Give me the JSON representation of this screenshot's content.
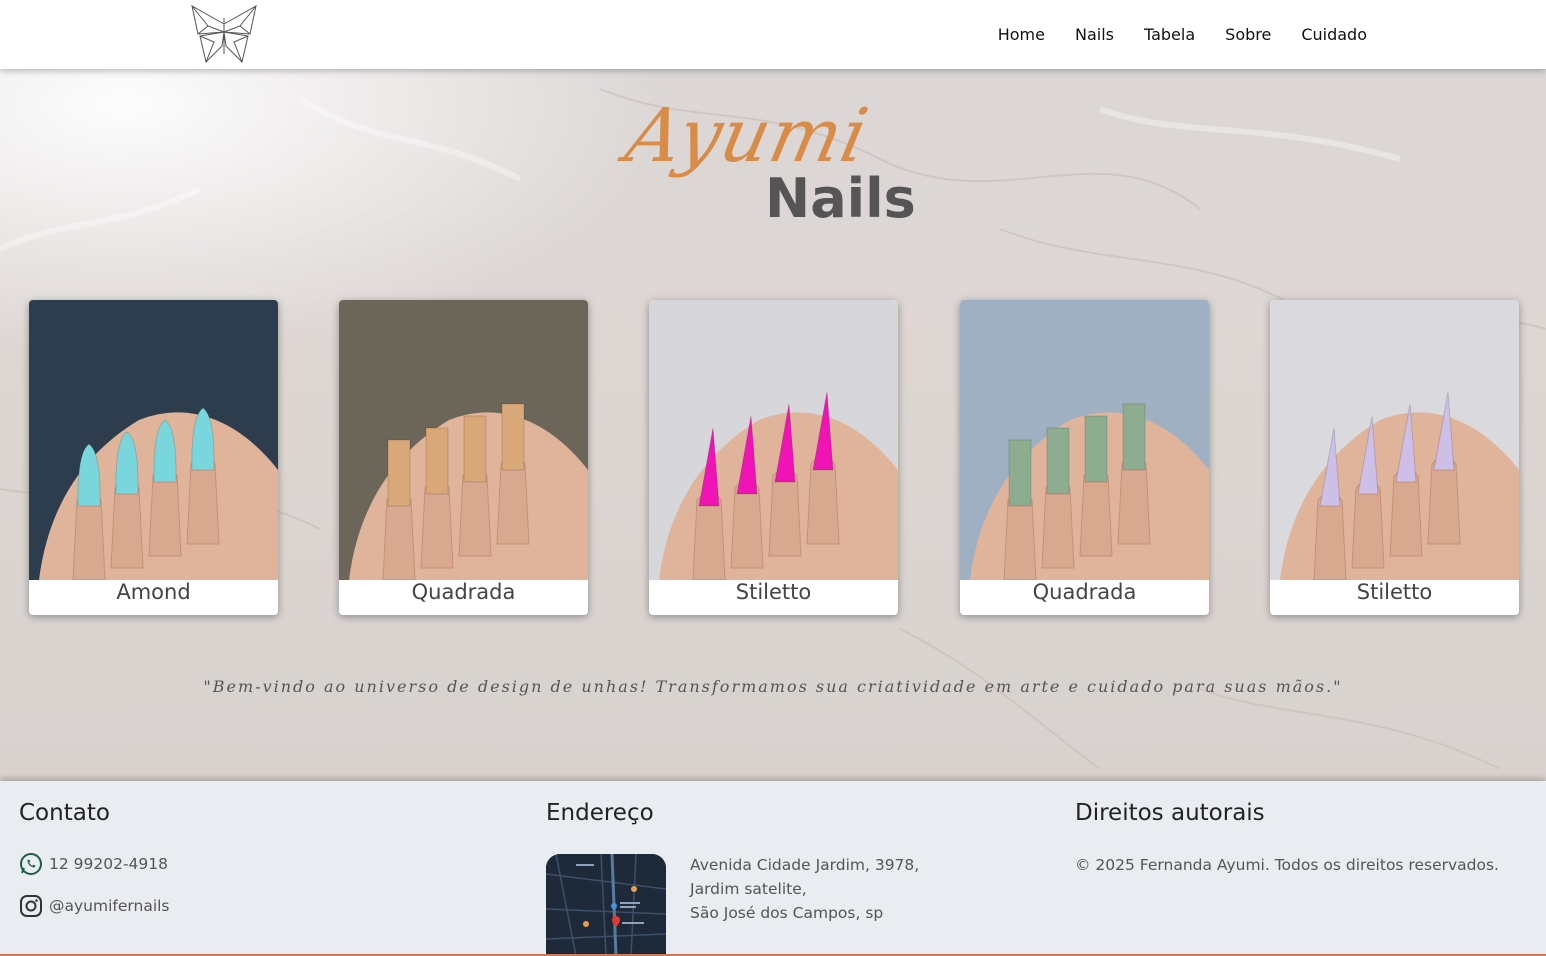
{
  "nav": {
    "items": [
      "Home",
      "Nails",
      "Tabela",
      "Sobre",
      "Cuidado"
    ]
  },
  "brand": {
    "script": "Ayumi",
    "bold": "Nails",
    "script_color": "#d98c48",
    "bold_color": "#555555"
  },
  "gallery": [
    {
      "label": "Amond",
      "nail_color": "#79d6dc"
    },
    {
      "label": "Quadrada",
      "nail_color": "#d9a878"
    },
    {
      "label": "Stiletto",
      "nail_color": "#f013b6"
    },
    {
      "label": "Quadrada",
      "nail_color": "#8eac90"
    },
    {
      "label": "Stiletto",
      "nail_color": "#cdbfe8"
    }
  ],
  "quote": "\"Bem-vindo ao universo de design de unhas! Transformamos sua criatividade em arte e cuidado para suas mãos.\"",
  "footer": {
    "contact": {
      "title": "Contato",
      "phone": "12 99202-4918",
      "instagram": "@ayumifernails",
      "phone_icon": "whatsapp-icon",
      "instagram_icon": "instagram-icon"
    },
    "address": {
      "title": "Endereço",
      "line1": "Avenida Cidade Jardim, 3978,",
      "line2": "Jardim satelite,",
      "line3": "São José dos Campos, sp"
    },
    "copyright": {
      "title": "Direitos autorais",
      "text": "© 2025 Fernanda Ayumi. Todos os direitos reservados."
    }
  }
}
